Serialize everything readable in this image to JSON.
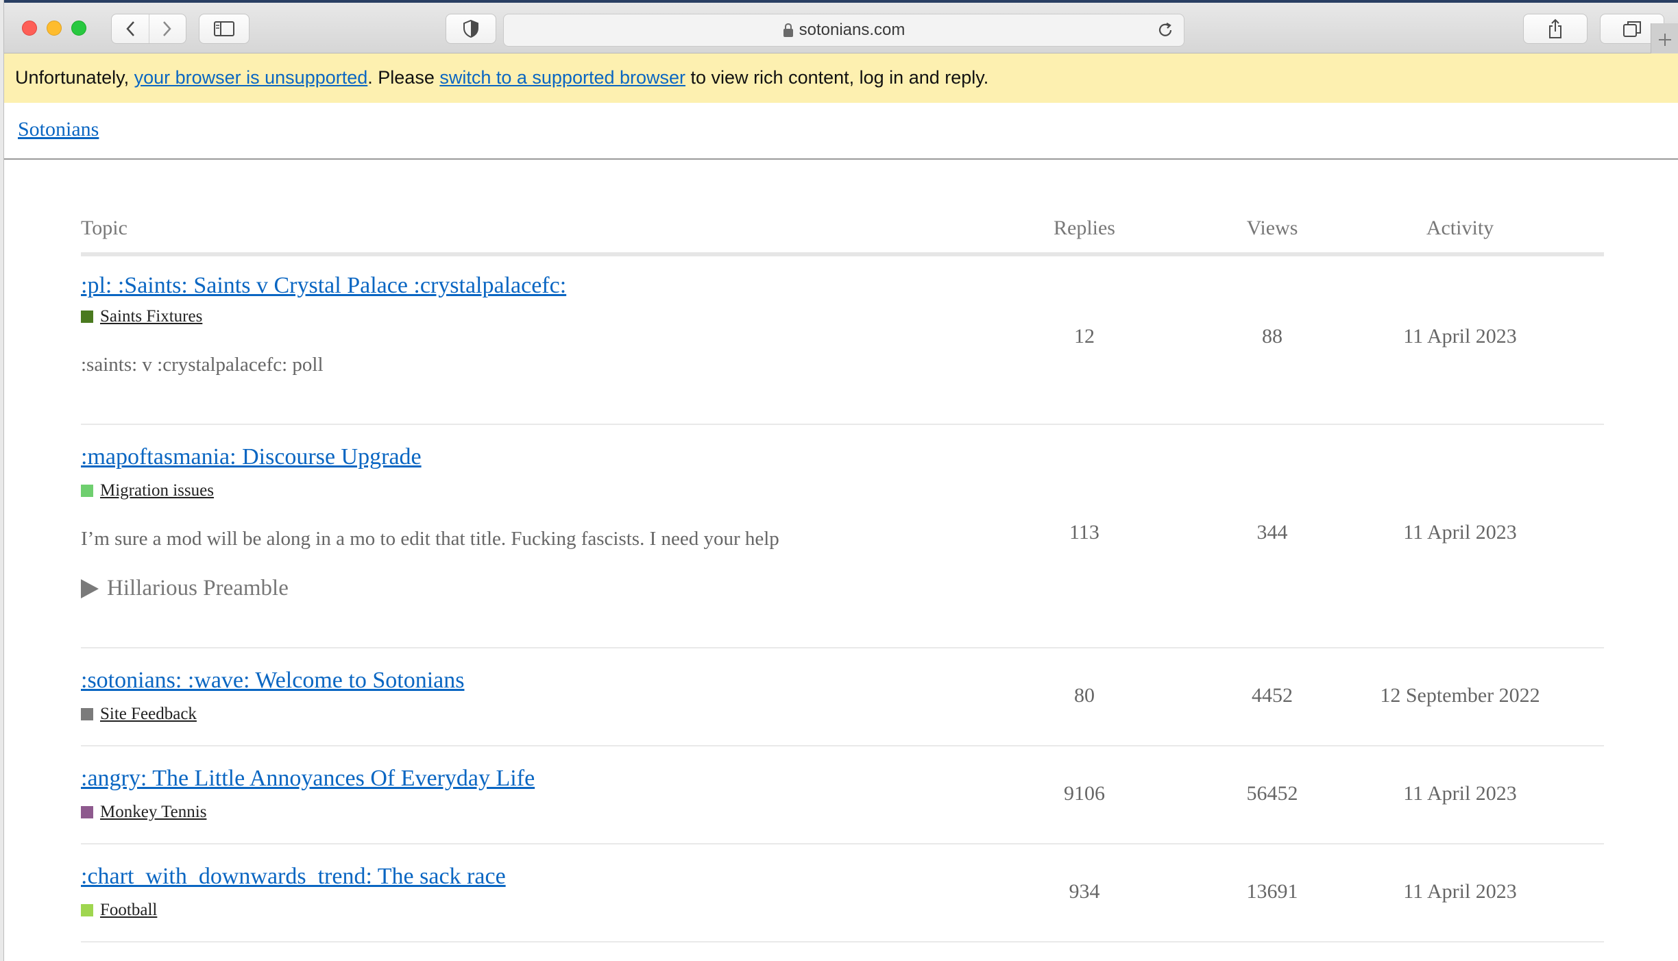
{
  "browser": {
    "url": "sotonians.com"
  },
  "banner": {
    "prefix": "Unfortunately, ",
    "link1": "your browser is unsupported",
    "middle": ". Please ",
    "link2": "switch to a supported browser",
    "suffix": " to view rich content, log in and reply."
  },
  "site": {
    "name": "Sotonians"
  },
  "table": {
    "headers": {
      "topic": "Topic",
      "replies": "Replies",
      "views": "Views",
      "activity": "Activity"
    },
    "rows": [
      {
        "title": ":pl: :Saints: Saints v Crystal Palace :crystalpalacefc:",
        "category": "Saints Fixtures",
        "category_color": "#4a7a1f",
        "excerpt": ":saints: v :crystalpalacefc: poll",
        "replies": "12",
        "views": "88",
        "activity": "11 April 2023"
      },
      {
        "title": ":mapoftasmania: Discourse Upgrade",
        "category": "Migration issues",
        "category_color": "#6fcf6f",
        "excerpt": "I’m sure a mod will be along in a mo to edit that title. Fucking fascists. I need your help",
        "details": "Hillarious Preamble",
        "replies": "113",
        "views": "344",
        "activity": "11 April 2023"
      },
      {
        "title": ":sotonians: :wave: Welcome to Sotonians",
        "category": "Site Feedback",
        "category_color": "#7b7b7b",
        "replies": "80",
        "views": "4452",
        "activity": "12 September 2022"
      },
      {
        "title": ":angry: The Little Annoyances Of Everyday Life",
        "category": "Monkey Tennis",
        "category_color": "#8e5a8e",
        "replies": "9106",
        "views": "56452",
        "activity": "11 April 2023"
      },
      {
        "title": ":chart_with_downwards_trend: The sack race",
        "category": "Football",
        "category_color": "#9fd64f",
        "replies": "934",
        "views": "13691",
        "activity": "11 April 2023"
      }
    ]
  }
}
